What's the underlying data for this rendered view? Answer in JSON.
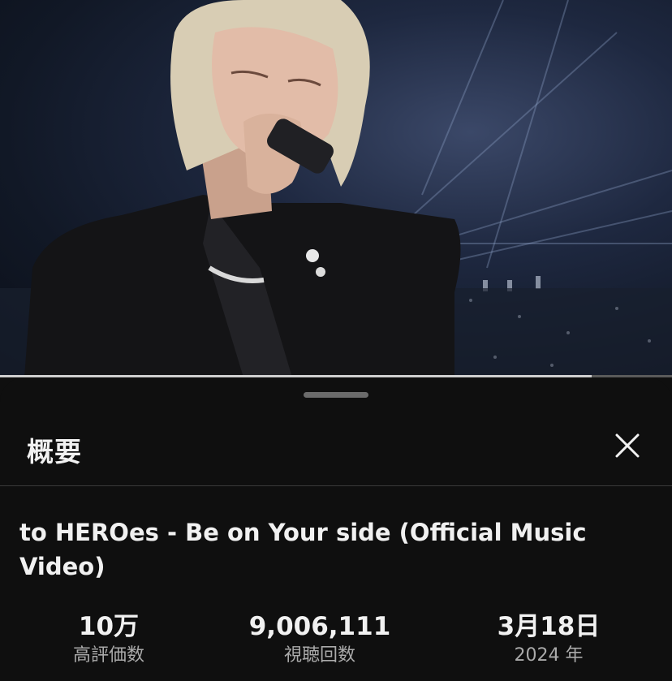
{
  "video": {
    "progress_fraction": 0.88
  },
  "sheet": {
    "title": "概要",
    "close_icon": "close-icon",
    "video_title": "to HEROes - Be on Your side (Official Music Video)",
    "stats": [
      {
        "value": "10万",
        "label": "高評価数"
      },
      {
        "value": "9,006,111",
        "label": "視聴回数"
      },
      {
        "value": "3月18日",
        "label": "2024 年"
      }
    ]
  },
  "colors": {
    "background": "#0f0f0f",
    "text_primary": "#f1f1f1",
    "text_secondary": "#aaaaaa",
    "divider": "#3a3a3a"
  }
}
